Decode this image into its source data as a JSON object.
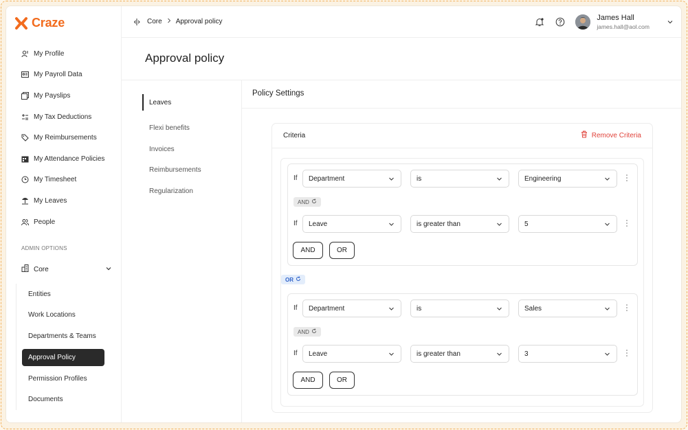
{
  "app": {
    "brand": "Craze",
    "brand_color": "#f26b1d"
  },
  "sidebar": {
    "items": [
      {
        "label": "My Profile",
        "icon": "user-icon"
      },
      {
        "label": "My Payroll Data",
        "icon": "id-card-icon"
      },
      {
        "label": "My Payslips",
        "icon": "payslips-icon"
      },
      {
        "label": "My Tax Deductions",
        "icon": "tax-icon"
      },
      {
        "label": "My Reimbursements",
        "icon": "tag-icon"
      },
      {
        "label": "My Attendance Policies",
        "icon": "calendar-icon"
      },
      {
        "label": "My Timesheet",
        "icon": "clock-icon"
      },
      {
        "label": "My Leaves",
        "icon": "beach-icon"
      },
      {
        "label": "People",
        "icon": "people-icon"
      }
    ],
    "section_label": "ADMIN OPTIONS",
    "core_label": "Core",
    "sub_items": [
      {
        "label": "Entities"
      },
      {
        "label": "Work Locations"
      },
      {
        "label": "Departments & Teams"
      },
      {
        "label": "Approval Policy",
        "active": true
      },
      {
        "label": "Permission Profiles"
      },
      {
        "label": "Documents"
      }
    ]
  },
  "header": {
    "breadcrumb": [
      "Core",
      "Approval policy"
    ],
    "user_name": "James Hall",
    "user_email": "james.hall@aol.com"
  },
  "page": {
    "title": "Approval policy"
  },
  "policy_nav": {
    "items": [
      "Leaves",
      "Flexi benefits",
      "Invoices",
      "Reimbursements",
      "Regularization"
    ],
    "active": "Leaves"
  },
  "panel": {
    "title": "Policy Settings",
    "criteria_label": "Criteria",
    "remove_label": "Remove Criteria",
    "remove_color": "#e0423a",
    "group_connector": "OR",
    "groups": [
      {
        "rows": [
          {
            "if": "If",
            "field": "Department",
            "operator": "is",
            "value": "Engineering"
          },
          {
            "if": "If",
            "field": "Leave",
            "operator": "is greater than",
            "value": "5"
          }
        ],
        "connector": "AND",
        "buttons": [
          "AND",
          "OR"
        ]
      },
      {
        "rows": [
          {
            "if": "If",
            "field": "Department",
            "operator": "is",
            "value": "Sales"
          },
          {
            "if": "If",
            "field": "Leave",
            "operator": "is greater than",
            "value": "3"
          }
        ],
        "connector": "AND",
        "buttons": [
          "AND",
          "OR"
        ]
      }
    ]
  }
}
